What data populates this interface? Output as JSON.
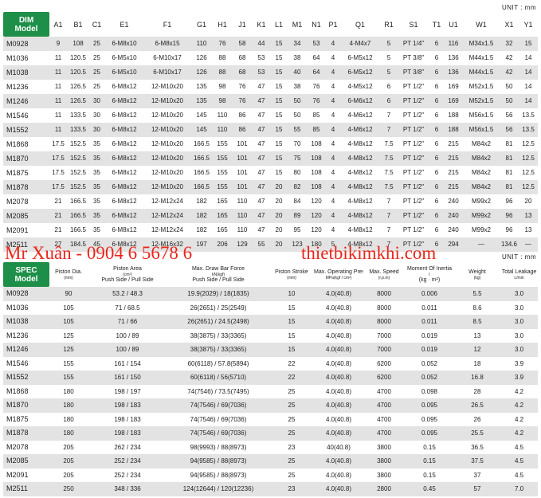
{
  "unit_label": "UNIT : mm",
  "dim": {
    "corner": [
      "DIM",
      "Model"
    ],
    "columns": [
      "A1",
      "B1",
      "C1",
      "E1",
      "F1",
      "G1",
      "H1",
      "J1",
      "K1",
      "L1",
      "M1",
      "N1",
      "P1",
      "Q1",
      "R1",
      "S1",
      "T1",
      "U1",
      "W1",
      "X1",
      "Y1"
    ],
    "rows": [
      [
        "M0928",
        "9",
        "108",
        "25",
        "6-M8x10",
        "6-M8x15",
        "110",
        "76",
        "58",
        "44",
        "15",
        "34",
        "53",
        "4",
        "4-M4x7",
        "5",
        "PT 1/4\"",
        "6",
        "116",
        "M34x1.5",
        "32",
        "15"
      ],
      [
        "M1036",
        "11",
        "120.5",
        "25",
        "6-M5x10",
        "6-M10x17",
        "126",
        "88",
        "68",
        "53",
        "15",
        "38",
        "64",
        "4",
        "6-M5x12",
        "5",
        "PT 3/8\"",
        "6",
        "136",
        "M44x1.5",
        "42",
        "14"
      ],
      [
        "M1038",
        "11",
        "120.5",
        "25",
        "6-M5x10",
        "6-M10x17",
        "126",
        "88",
        "68",
        "53",
        "15",
        "40",
        "64",
        "4",
        "6-M5x12",
        "5",
        "PT 3/8\"",
        "6",
        "136",
        "M44x1.5",
        "42",
        "14"
      ],
      [
        "M1236",
        "11",
        "126.5",
        "25",
        "6-M8x12",
        "12-M10x20",
        "135",
        "98",
        "76",
        "47",
        "15",
        "38",
        "76",
        "4",
        "4-M5x12",
        "6",
        "PT 1/2\"",
        "6",
        "169",
        "M52x1.5",
        "50",
        "14"
      ],
      [
        "M1246",
        "11",
        "126.5",
        "30",
        "6-M8x12",
        "12-M10x20",
        "135",
        "98",
        "76",
        "47",
        "15",
        "50",
        "76",
        "4",
        "6-M6x12",
        "6",
        "PT 1/2\"",
        "6",
        "169",
        "M52x1.5",
        "50",
        "14"
      ],
      [
        "M1546",
        "11",
        "133.5",
        "30",
        "6-M8x12",
        "12-M10x20",
        "145",
        "110",
        "86",
        "47",
        "15",
        "50",
        "85",
        "4",
        "4-M6x12",
        "7",
        "PT 1/2\"",
        "6",
        "188",
        "M56x1.5",
        "56",
        "13.5"
      ],
      [
        "M1552",
        "11",
        "133.5",
        "30",
        "6-M8x12",
        "12-M10x20",
        "145",
        "110",
        "86",
        "47",
        "15",
        "55",
        "85",
        "4",
        "4-M6x12",
        "7",
        "PT 1/2\"",
        "6",
        "188",
        "M56x1.5",
        "56",
        "13.5"
      ],
      [
        "M1868",
        "17.5",
        "152.5",
        "35",
        "6-M8x12",
        "12-M10x20",
        "166.5",
        "155",
        "101",
        "47",
        "15",
        "70",
        "108",
        "4",
        "4-M8x12",
        "7.5",
        "PT 1/2\"",
        "6",
        "215",
        "M84x2",
        "81",
        "12.5"
      ],
      [
        "M1870",
        "17.5",
        "152.5",
        "35",
        "6-M8x12",
        "12-M10x20",
        "166.5",
        "155",
        "101",
        "47",
        "15",
        "75",
        "108",
        "4",
        "4-M8x12",
        "7.5",
        "PT 1/2\"",
        "6",
        "215",
        "M84x2",
        "81",
        "12.5"
      ],
      [
        "M1875",
        "17.5",
        "152.5",
        "35",
        "6-M8x12",
        "12-M10x20",
        "166.5",
        "155",
        "101",
        "47",
        "15",
        "80",
        "108",
        "4",
        "4-M8x12",
        "7.5",
        "PT 1/2\"",
        "6",
        "215",
        "M84x2",
        "81",
        "12.5"
      ],
      [
        "M1878",
        "17.5",
        "152.5",
        "35",
        "6-M8x12",
        "12-M10x20",
        "166.5",
        "155",
        "101",
        "47",
        "20",
        "82",
        "108",
        "4",
        "4-M8x12",
        "7.5",
        "PT 1/2\"",
        "6",
        "215",
        "M84x2",
        "81",
        "12.5"
      ],
      [
        "M2078",
        "21",
        "166.5",
        "35",
        "6-M8x12",
        "12-M12x24",
        "182",
        "165",
        "110",
        "47",
        "20",
        "84",
        "120",
        "4",
        "4-M8x12",
        "7",
        "PT 1/2\"",
        "6",
        "240",
        "M99x2",
        "96",
        "20"
      ],
      [
        "M2085",
        "21",
        "166.5",
        "35",
        "6-M8x12",
        "12-M12x24",
        "182",
        "165",
        "110",
        "47",
        "20",
        "89",
        "120",
        "4",
        "4-M8x12",
        "7",
        "PT 1/2\"",
        "6",
        "240",
        "M99x2",
        "96",
        "13"
      ],
      [
        "M2091",
        "21",
        "166.5",
        "35",
        "6-M8x12",
        "12-M12x24",
        "182",
        "165",
        "110",
        "47",
        "20",
        "95",
        "120",
        "4",
        "4-M8x12",
        "7",
        "PT 1/2\"",
        "6",
        "240",
        "M99x2",
        "96",
        "13"
      ],
      [
        "M2511",
        "27",
        "184.5",
        "45",
        "6-M8x12",
        "12-M16x32",
        "197",
        "206",
        "129",
        "55",
        "20",
        "123",
        "180",
        "5",
        "4-M8x12",
        "7",
        "PT 1/2\"",
        "6",
        "294",
        "—",
        "134.6",
        "—"
      ]
    ]
  },
  "watermark": {
    "left": "Mr Xuân - 0904 6 5678 6",
    "right": "thietbikimkhi.com"
  },
  "spec": {
    "corner": [
      "SPEC",
      "Model"
    ],
    "columns": [
      {
        "label": "Piston Dia.",
        "unit": "(mm)"
      },
      {
        "label": "Piston Area",
        "unit": "(cm²)",
        "sub": "Push Side / Pull Side"
      },
      {
        "label": "Max. Draw Bar Force",
        "unit": "kN(kgf)",
        "sub": "Push Side / Pull Side"
      },
      {
        "label": "Piston Stroke",
        "unit": "(mm)"
      },
      {
        "label": "Max. Operating Pressure",
        "unit": "MPa(kgf / cm²)"
      },
      {
        "label": "Max. Speed",
        "unit": "(r.p.m)"
      },
      {
        "label": "Moment Of Inertia",
        "unit": "I",
        "sub": "(kg · m²)"
      },
      {
        "label": "Weight",
        "unit": "(kg)"
      },
      {
        "label": "Total Leakage",
        "unit": "L/min"
      }
    ],
    "rows": [
      [
        "M0928",
        "90",
        "53.2 / 48.3",
        "19.9(2029) / 18(1835)",
        "10",
        "4.0(40.8)",
        "8000",
        "0.006",
        "5.5",
        "3.0"
      ],
      [
        "M1036",
        "105",
        "71 / 68.5",
        "26(2651) / 25(2549)",
        "15",
        "4.0(40.8)",
        "8000",
        "0.011",
        "8.6",
        "3.0"
      ],
      [
        "M1038",
        "105",
        "71 / 66",
        "26(2651) / 24.5(2498)",
        "15",
        "4.0(40.8)",
        "8000",
        "0.011",
        "8.5",
        "3.0"
      ],
      [
        "M1236",
        "125",
        "100 / 89",
        "38(3875) / 33(3365)",
        "15",
        "4.0(40.8)",
        "7000",
        "0.019",
        "13",
        "3.0"
      ],
      [
        "M1246",
        "125",
        "100 / 89",
        "38(3875) / 33(3365)",
        "15",
        "4.0(40.8)",
        "7000",
        "0.019",
        "12",
        "3.0"
      ],
      [
        "M1546",
        "155",
        "161 / 154",
        "60(6118) / 57.8(5894)",
        "22",
        "4.0(40.8)",
        "6200",
        "0.052",
        "18",
        "3.9"
      ],
      [
        "M1552",
        "155",
        "161 / 150",
        "60(6118) / 56(5710)",
        "22",
        "4.0(40.8)",
        "6200",
        "0.052",
        "16.8",
        "3.9"
      ],
      [
        "M1868",
        "180",
        "198 / 197",
        "74(7546) / 73.5(7495)",
        "25",
        "4.0(40.8)",
        "4700",
        "0.098",
        "28",
        "4.2"
      ],
      [
        "M1870",
        "180",
        "198 / 183",
        "74(7546) / 69(7036)",
        "25",
        "4.0(40.8)",
        "4700",
        "0.095",
        "26.5",
        "4.2"
      ],
      [
        "M1875",
        "180",
        "198 / 183",
        "74(7546) / 69(7036)",
        "25",
        "4.0(40.8)",
        "4700",
        "0.095",
        "26",
        "4.2"
      ],
      [
        "M1878",
        "180",
        "198 / 183",
        "74(7546) / 69(7036)",
        "25",
        "4.0(40.8)",
        "4700",
        "0.095",
        "25.5",
        "4.2"
      ],
      [
        "M2078",
        "205",
        "262 / 234",
        "98(9993) / 88(8973)",
        "23",
        "40(40.8)",
        "3800",
        "0.15",
        "36.5",
        "4.5"
      ],
      [
        "M2085",
        "205",
        "252 / 234",
        "94(9585) / 88(8973)",
        "25",
        "4.0(40.8)",
        "3800",
        "0.15",
        "37.5",
        "4.5"
      ],
      [
        "M2091",
        "205",
        "252 / 234",
        "94(9585) / 88(8973)",
        "25",
        "4.0(40.8)",
        "3800",
        "0.15",
        "37",
        "4.5"
      ],
      [
        "M2511",
        "250",
        "348 / 336",
        "124(12644) / 120(12236)",
        "23",
        "4.0(40.8)",
        "2800",
        "0.45",
        "57",
        "7.0"
      ]
    ]
  }
}
